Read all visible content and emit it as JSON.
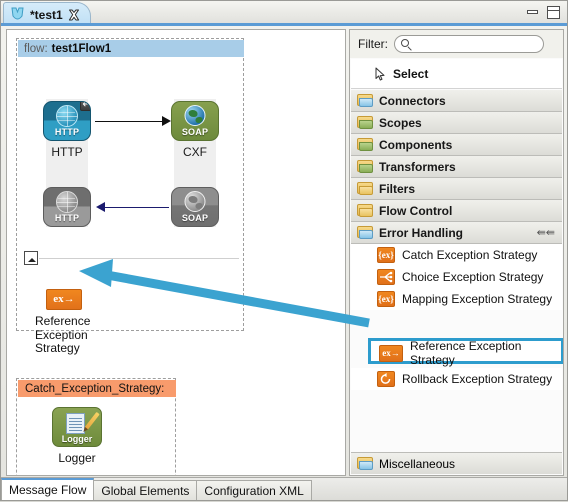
{
  "window": {
    "tab_title": "*test1",
    "tab_icon": "mule-icon",
    "close_icon": "close-icon",
    "minimize_icon": "minimize-icon",
    "maximize_icon": "maximize-icon"
  },
  "canvas": {
    "flow": {
      "header_key": "flow:",
      "header_value": "test1Flow1",
      "nodes": [
        {
          "id": "http-in",
          "icon_text": "HTTP",
          "label": "HTTP",
          "state": "active"
        },
        {
          "id": "cxf",
          "icon_text": "SOAP",
          "label": "CXF",
          "state": "active"
        },
        {
          "id": "http-out",
          "icon_text": "HTTP",
          "label": "",
          "state": "inactive"
        },
        {
          "id": "soap-out",
          "icon_text": "SOAP",
          "label": "",
          "state": "inactive"
        }
      ],
      "reference_exception": {
        "icon_text": "ex",
        "label": "Reference\nException\nStrategy",
        "label_line1": "Reference",
        "label_line2": "Exception",
        "label_line3": "Strategy"
      }
    },
    "catch_scope": {
      "header": "Catch_Exception_Strategy:",
      "logger": {
        "icon_text": "Logger",
        "label": "Logger"
      }
    }
  },
  "palette": {
    "filter_label": "Filter:",
    "filter_value": "",
    "filter_placeholder": "",
    "select_label": "Select",
    "groups": [
      {
        "label": "Connectors",
        "folder": "blue"
      },
      {
        "label": "Scopes",
        "folder": "green"
      },
      {
        "label": "Components",
        "folder": "green"
      },
      {
        "label": "Transformers",
        "folder": "green"
      },
      {
        "label": "Filters",
        "folder": "yellow"
      },
      {
        "label": "Flow Control",
        "folder": "yellow"
      },
      {
        "label": "Error Handling",
        "folder": "blue",
        "expanded": true
      }
    ],
    "error_handling_items": [
      {
        "label": "Catch Exception Strategy",
        "icon": "{ex}",
        "highlighted": false
      },
      {
        "label": "Choice Exception Strategy",
        "icon": "choice",
        "highlighted": false
      },
      {
        "label": "Mapping Exception Strategy",
        "icon": "{ex}",
        "highlighted": false
      },
      {
        "label": "Reference Exception Strategy",
        "icon": "ex→",
        "highlighted": true
      },
      {
        "label": "Rollback Exception Strategy",
        "icon": "rollback",
        "highlighted": false
      }
    ],
    "miscellaneous_label": "Miscellaneous",
    "collapse_icon": "collapse-all-icon",
    "highlight_color": "#2d9ccd"
  },
  "bottom_tabs": [
    {
      "label": "Message Flow",
      "active": true
    },
    {
      "label": "Global Elements",
      "active": false
    },
    {
      "label": "Configuration XML",
      "active": false
    }
  ]
}
